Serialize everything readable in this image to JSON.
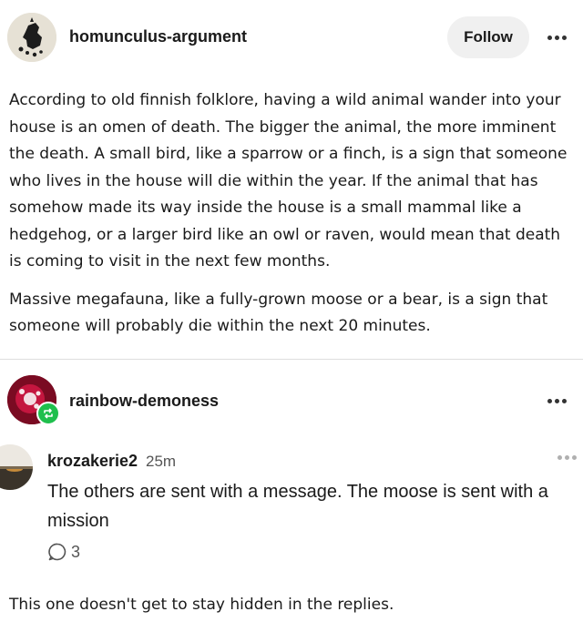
{
  "post": {
    "author": "homunculus-argument",
    "follow_label": "Follow",
    "paragraphs": [
      "According to old finnish folklore, having a wild animal wander into your house is an omen of death. The bigger the animal, the more imminent the death. A small bird, like a sparrow or a finch, is a sign that someone who lives in the house will die within the year. If the animal that has somehow made its way inside the house is a small mammal like a hedgehog, or a larger bird like an owl or raven, would mean that death is coming to visit in the next few months.",
      "Massive megafauna, like a fully-grown moose or a bear, is a sign that someone will probably die within the next 20 minutes."
    ]
  },
  "reblog": {
    "author": "rainbow-demoness",
    "comment": {
      "user": "krozakerie2",
      "time": "25m",
      "text": "The others are sent with a message. The moose is sent with a mission",
      "reply_count": "3"
    },
    "body": "This one doesn't get to stay hidden in the replies."
  },
  "icons": {
    "more": "more-icon",
    "reblog": "reblog-icon",
    "reply": "comment-bubble-icon"
  },
  "colors": {
    "reblog_badge": "#1fbf4d",
    "follow_bg": "#f0f0f0"
  }
}
